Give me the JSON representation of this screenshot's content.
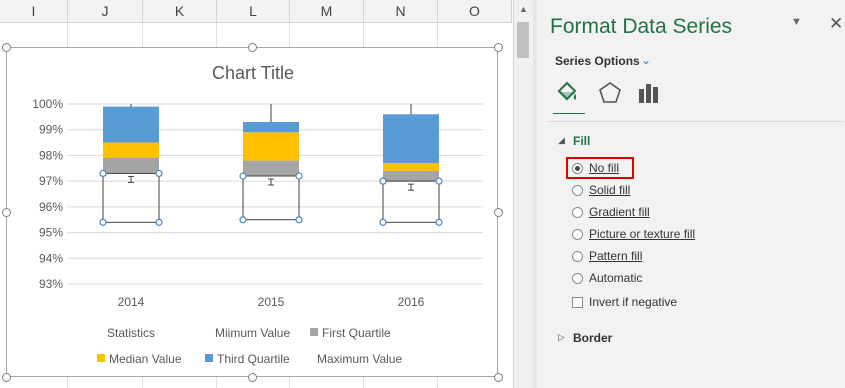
{
  "columns": [
    "I",
    "J",
    "K",
    "L",
    "M",
    "N",
    "O"
  ],
  "chart_data": {
    "type": "bar",
    "stacked": true,
    "title": "Chart Title",
    "categories": [
      "2014",
      "2015",
      "2016"
    ],
    "ylim": [
      0.93,
      1.0
    ],
    "yticks": [
      "93%",
      "94%",
      "95%",
      "96%",
      "97%",
      "98%",
      "99%",
      "100%"
    ],
    "series": [
      {
        "name": "Statistics",
        "values": [
          0.954,
          0.955,
          0.954
        ],
        "color": "none"
      },
      {
        "name": "Miimum Value",
        "values": [
          0.019,
          0.017,
          0.016
        ],
        "color": "none"
      },
      {
        "name": "First Quartile",
        "values": [
          0.006,
          0.006,
          0.004
        ],
        "color": "#a5a5a5"
      },
      {
        "name": "Median Value",
        "values": [
          0.006,
          0.011,
          0.003
        ],
        "color": "#ffc000"
      },
      {
        "name": "Third Quartile",
        "values": [
          0.014,
          0.004,
          0.019
        ],
        "color": "#5b9bd5"
      },
      {
        "name": "Maximum Value",
        "values": [
          0.001,
          0.008,
          0.004
        ],
        "color": "none"
      }
    ],
    "legend": "bottom",
    "grid": true
  },
  "pane": {
    "title": "Format Data Series",
    "menu_glyph": "▼",
    "close_glyph": "✕",
    "series_options_label": "Series Options",
    "series_options_chevron": "⌄",
    "fill_section": "Fill",
    "fill_section_glyph": "◢",
    "border_section": "Border",
    "border_section_glyph": "▷",
    "options": [
      {
        "label": "No fill",
        "checked": true
      },
      {
        "label": "Solid fill",
        "checked": false
      },
      {
        "label": "Gradient fill",
        "checked": false
      },
      {
        "label": "Picture or texture fill",
        "checked": false
      },
      {
        "label": "Pattern fill",
        "checked": false
      },
      {
        "label": "Automatic",
        "checked": false
      }
    ],
    "invert_label": "Invert if negative",
    "accent_color": "#217346",
    "highlight_color": "#e00000",
    "tab_icons": [
      "paint-bucket-icon",
      "pentagon-icon",
      "bar-chart-icon"
    ]
  },
  "scroll_up_glyph": "▲"
}
